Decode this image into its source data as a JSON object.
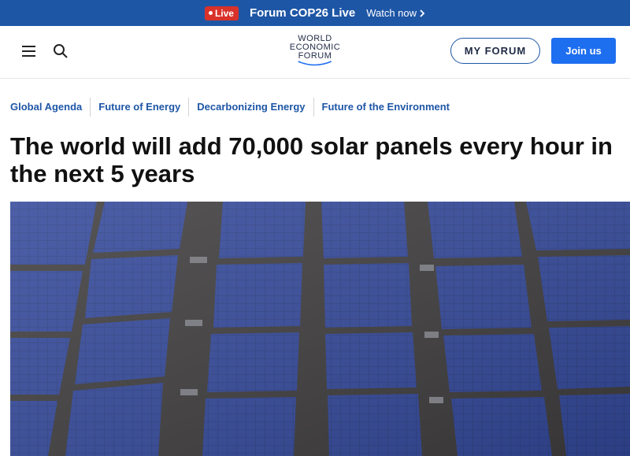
{
  "banner": {
    "live_label": "Live",
    "title": "Forum COP26 Live",
    "watch_label": "Watch now"
  },
  "header": {
    "logo_lines": [
      "WORLD",
      "ECONOMIC",
      "FORUM"
    ],
    "my_forum_label": "MY FORUM",
    "join_label": "Join us"
  },
  "topics": [
    "Global Agenda",
    "Future of Energy",
    "Decarbonizing Energy",
    "Future of the Environment"
  ],
  "article": {
    "headline": "The world will add 70,000 solar panels every hour in the next 5 years"
  },
  "colors": {
    "banner_bg": "#1e56a6",
    "live_red": "#d9322a",
    "join_blue": "#1e6ef0",
    "topic_blue": "#1e56a6",
    "panel_blue": "#2c3f86"
  },
  "icons": {
    "menu": "hamburger-icon",
    "search": "search-icon",
    "watch_chevron": "chevron-right-icon"
  }
}
